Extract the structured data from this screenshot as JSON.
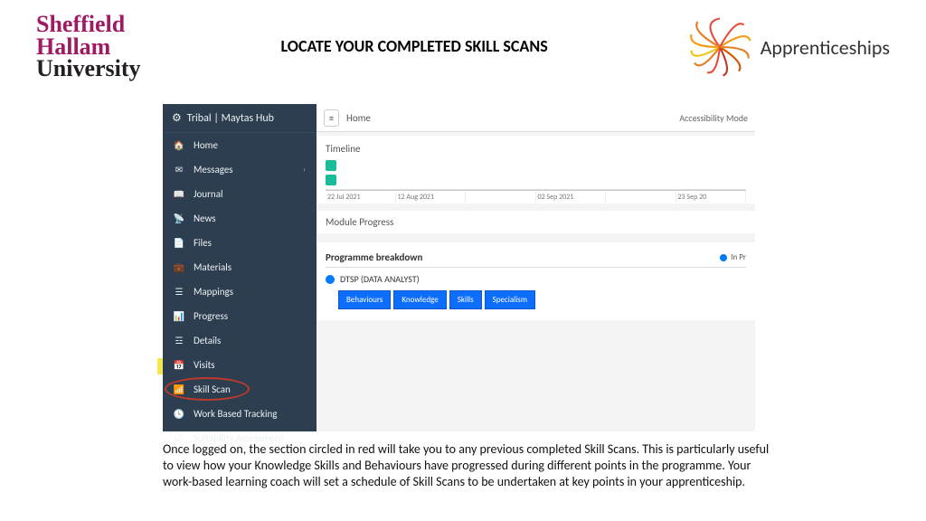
{
  "header": {
    "logo_line1": "Sheffield",
    "logo_line2": "Hallam",
    "logo_line3": "University",
    "title": "LOCATE YOUR COMPLETED SKILL SCANS",
    "right_logo": "Apprenticeships"
  },
  "sidebar": {
    "brand": "Tribal | Maytas Hub",
    "items": [
      {
        "icon": "home",
        "label": "Home"
      },
      {
        "icon": "envelope",
        "label": "Messages",
        "chevron": true
      },
      {
        "icon": "book",
        "label": "Journal"
      },
      {
        "icon": "rss",
        "label": "News"
      },
      {
        "icon": "file",
        "label": "Files"
      },
      {
        "icon": "briefcase",
        "label": "Materials"
      },
      {
        "icon": "list",
        "label": "Mappings"
      },
      {
        "icon": "chart",
        "label": "Progress"
      },
      {
        "icon": "lines",
        "label": "Details"
      },
      {
        "icon": "calendar",
        "label": "Visits"
      },
      {
        "icon": "bars",
        "label": "Skill Scan",
        "highlight": true
      },
      {
        "icon": "clock",
        "label": "Work Based Tracking"
      },
      {
        "icon": "check",
        "label": "Suitability Assessment"
      }
    ]
  },
  "topbar": {
    "breadcrumb": "Home",
    "accessibility": "Accessibility Mode"
  },
  "timeline": {
    "label": "Timeline",
    "dates": [
      "22 Jul 2021",
      "12 Aug 2021",
      "",
      "02 Sep 2021",
      "",
      "23 Sep 20"
    ]
  },
  "module": {
    "label": "Module Progress",
    "breakdown_title": "Programme breakdown",
    "legend": "In Pr",
    "programme": "DTSP (DATA ANALYST)",
    "chips": [
      "Behaviours",
      "Knowledge",
      "Skills",
      "Specialism"
    ]
  },
  "caption": "Once logged on, the section circled in red will take you to any previous completed Skill Scans. This is particularly useful to view how your Knowledge Skills and Behaviours have progressed during different points in the programme. Your work-based learning coach will set a schedule of Skill Scans to be undertaken at key points in your apprenticeship."
}
